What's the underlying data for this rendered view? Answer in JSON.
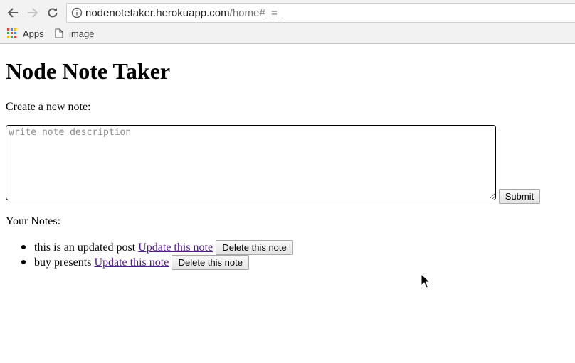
{
  "browser": {
    "url_host": "nodenotetaker.herokuapp.com",
    "url_path": "/home#_=_",
    "bookmarks": [
      {
        "label": "Apps",
        "icon": "apps-grid-icon"
      },
      {
        "label": "image",
        "icon": "page-icon"
      }
    ]
  },
  "page": {
    "title": "Node Note Taker",
    "create_label": "Create a new note:",
    "textarea_placeholder": "write note description",
    "submit_label": "Submit",
    "notes_label": "Your Notes:",
    "notes": [
      {
        "text": "this is an updated post",
        "update_label": "Update this note",
        "delete_label": "Delete this note"
      },
      {
        "text": "buy presents",
        "update_label": "Update this note",
        "delete_label": "Delete this note"
      }
    ]
  },
  "colors": {
    "link": "#551a8b",
    "chrome_bg": "#f2f2f2"
  }
}
